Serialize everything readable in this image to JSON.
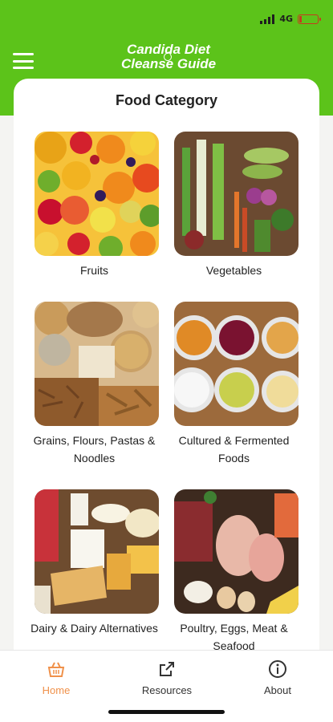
{
  "status": {
    "network": "4G"
  },
  "header": {
    "brand_line1": "Candida Diet",
    "brand_line2": "Cleanse Guide"
  },
  "content": {
    "title": "Food Category",
    "categories": [
      {
        "label": "Fruits"
      },
      {
        "label": "Vegetables"
      },
      {
        "label": "Grains, Flours, Pastas & Noodles"
      },
      {
        "label": "Cultured & Fermented Foods"
      },
      {
        "label": "Dairy & Dairy Alternatives"
      },
      {
        "label": "Poultry, Eggs, Meat & Seafood"
      }
    ]
  },
  "nav": {
    "items": [
      {
        "label": "Home",
        "icon": "home-basket-icon",
        "active": true
      },
      {
        "label": "Resources",
        "icon": "external-link-icon"
      },
      {
        "label": "About",
        "icon": "info-icon"
      }
    ]
  },
  "colors": {
    "brand_green": "#5cc31a",
    "active_nav": "#f0914a"
  }
}
